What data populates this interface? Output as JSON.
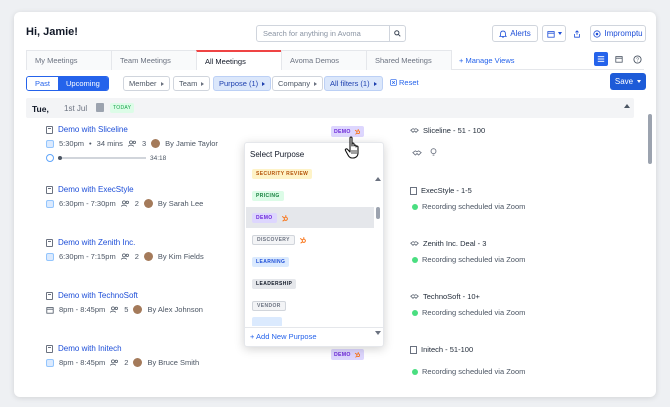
{
  "header": {
    "greeting": "Hi, Jamie!",
    "search_placeholder": "Search for anything in Avoma",
    "alerts_label": "Alerts",
    "impromptu_label": "Impromptu"
  },
  "tabs": [
    {
      "label": "My Meetings"
    },
    {
      "label": "Team Meetings"
    },
    {
      "label": "All Meetings"
    },
    {
      "label": "Avoma Demos"
    },
    {
      "label": "Shared Meetings"
    }
  ],
  "manage_views_label": "+ Manage Views",
  "filters": {
    "past_label": "Past",
    "upcoming_label": "Upcoming",
    "member_label": "Member",
    "team_label": "Team",
    "purpose_label": "Purpose (1)",
    "company_label": "Company",
    "all_filters_label": "All filters (1)",
    "reset_label": "Reset",
    "save_label": "Save"
  },
  "day": {
    "weekday": "Tue,",
    "date": "1st Jul",
    "today_badge": "TODAY"
  },
  "meetings": [
    {
      "title": "Demo with Sliceline",
      "time": "5:30pm",
      "duration": "34 mins",
      "attendees": "3",
      "by": "By Jamie Taylor",
      "recording_length": "34:18",
      "recording_progress": 0,
      "tag": "DEMO",
      "deal": "Sliceline - 51 - 100"
    },
    {
      "title": "Demo with ExecStyle",
      "time": "6:30pm - 7:30pm",
      "attendees": "2",
      "by": "By Sarah Lee",
      "deal": "ExecStyle - 1-5",
      "status": "Recording scheduled via Zoom"
    },
    {
      "title": "Demo with Zenith Inc.",
      "time": "6:30pm - 7:15pm",
      "attendees": "2",
      "by": "By Kim Fields",
      "deal": "Zenith Inc. Deal - 3",
      "status": "Recording scheduled via Zoom"
    },
    {
      "title": "Demo with TechnoSoft",
      "time": "8pm - 8:45pm",
      "attendees": "5",
      "by": "By Alex Johnson",
      "deal": "TechnoSoft - 10+",
      "status": "Recording scheduled via Zoom"
    },
    {
      "title": "Demo with Initech",
      "time": "8pm - 8:45pm",
      "attendees": "2",
      "by": "By Bruce Smith",
      "tag": "DEMO",
      "deal": "Initech - 51-100",
      "status": "Recording scheduled via Zoom"
    }
  ],
  "purpose_dropdown": {
    "title": "Select Purpose",
    "options": [
      {
        "label": "SECURITY REVIEW"
      },
      {
        "label": "PRICING"
      },
      {
        "label": "DEMO"
      },
      {
        "label": "DISCOVERY"
      },
      {
        "label": "LEARNING"
      },
      {
        "label": "LEADERSHIP"
      },
      {
        "label": "VENDOR"
      }
    ],
    "add_new_label": "+ Add New Purpose"
  },
  "colors": {
    "accent": "#2563eb",
    "active_tab_border": "#ef4444",
    "hubspot": "#f97316"
  }
}
